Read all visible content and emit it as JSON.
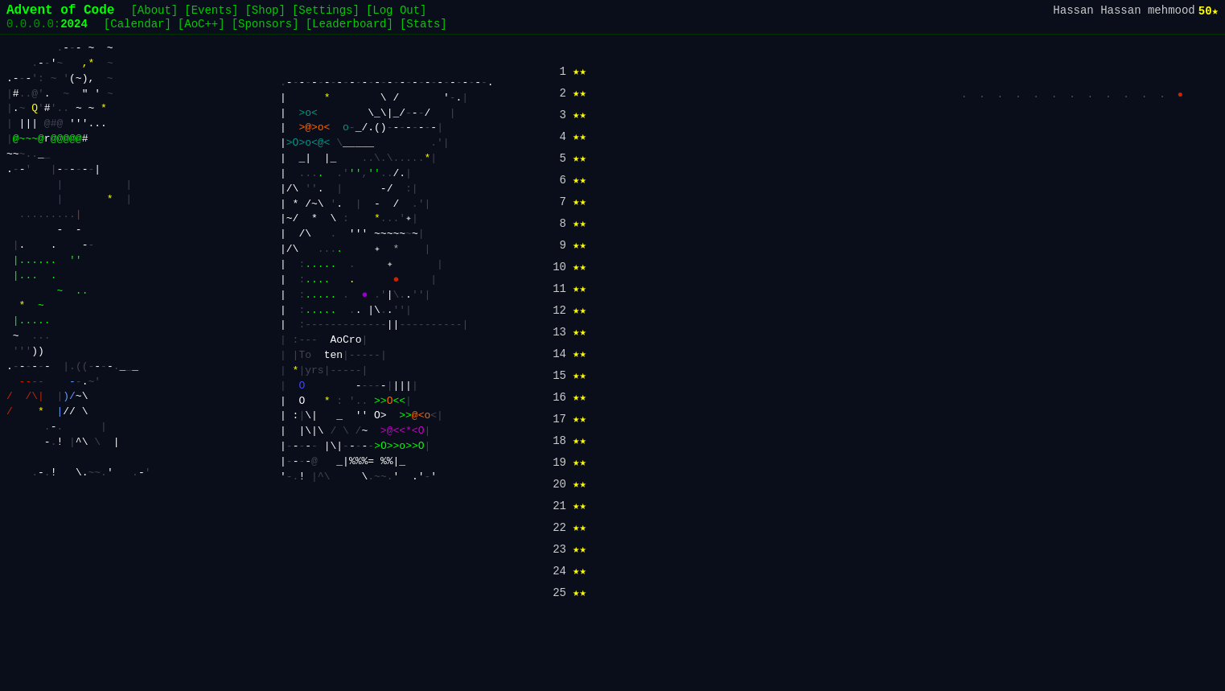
{
  "header": {
    "title": "Advent of Code",
    "subtitle": "0.0.0.0:",
    "year": "2024",
    "nav_top": [
      "[About]",
      "[Events]",
      "[Shop]",
      "[Settings]",
      "[Log Out]"
    ],
    "nav_bottom": [
      "[Calendar]",
      "[AoC++]",
      "[Sponsors]",
      "[Leaderboard]",
      "[Stats]"
    ],
    "user": "Hassan Hassan mehmood",
    "stars": "50★"
  },
  "days": [
    {
      "num": "1",
      "stars": "★★"
    },
    {
      "num": "2",
      "stars": "★★"
    },
    {
      "num": "3",
      "stars": "★★"
    },
    {
      "num": "4",
      "stars": "★★"
    },
    {
      "num": "5",
      "stars": "★★"
    },
    {
      "num": "6",
      "stars": "★★"
    },
    {
      "num": "7",
      "stars": "★★"
    },
    {
      "num": "8",
      "stars": "★★"
    },
    {
      "num": "9",
      "stars": "★★"
    },
    {
      "num": "10",
      "stars": "★★"
    },
    {
      "num": "11",
      "stars": "★★"
    },
    {
      "num": "12",
      "stars": "★★"
    },
    {
      "num": "13",
      "stars": "★★"
    },
    {
      "num": "14",
      "stars": "★★"
    },
    {
      "num": "15",
      "stars": "★★"
    },
    {
      "num": "16",
      "stars": "★★"
    },
    {
      "num": "17",
      "stars": "★★"
    },
    {
      "num": "18",
      "stars": "★★"
    },
    {
      "num": "19",
      "stars": "★★"
    },
    {
      "num": "20",
      "stars": "★★"
    },
    {
      "num": "21",
      "stars": "★★"
    },
    {
      "num": "22",
      "stars": "★★"
    },
    {
      "num": "23",
      "stars": "★★"
    },
    {
      "num": "24",
      "stars": "★★"
    },
    {
      "num": "25",
      "stars": "★★"
    }
  ]
}
